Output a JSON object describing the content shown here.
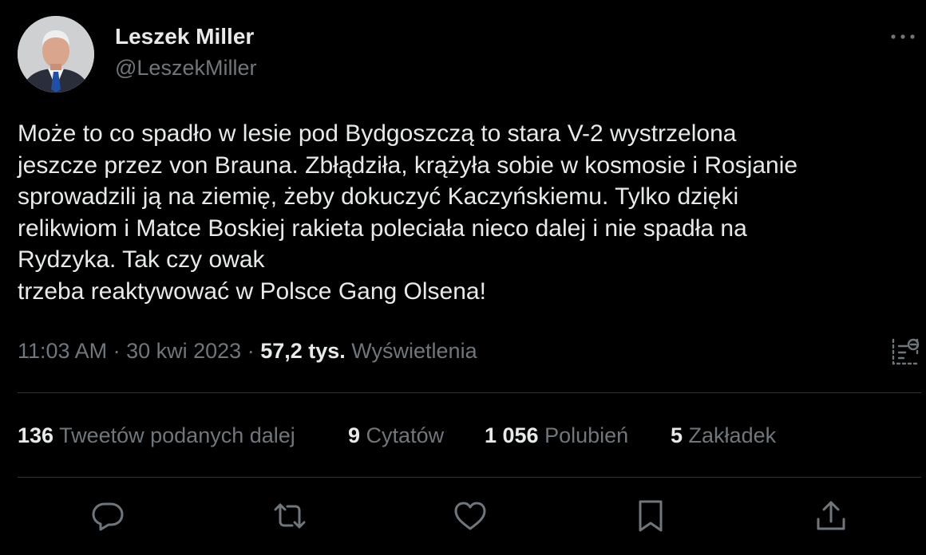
{
  "author": {
    "display_name": "Leszek Miller",
    "handle": "@LeszekMiller"
  },
  "tweet": {
    "text": "Może to co spadło w lesie pod Bydgoszczą to stara V-2 wystrzelona\njeszcze przez von Brauna. Zbłądziła, krążyła sobie w kosmosie i Rosjanie\nsprowadzili ją na ziemię, żeby dokuczyć Kaczyńskiemu. Tylko dzięki\nrelikwiom i Matce Boskiej rakieta poleciała nieco dalej i nie spadła na\nRydzyka. Tak czy owak\ntrzeba reaktywować w Polsce Gang Olsena!"
  },
  "meta": {
    "time": "11:03 AM",
    "separator": " · ",
    "date": "30 kwi 2023",
    "views_count": "57,2 tys.",
    "views_label": "Wyświetlenia"
  },
  "stats": {
    "retweets": {
      "count": "136",
      "label": "Tweetów podanych dalej"
    },
    "quotes": {
      "count": "9",
      "label": "Cytatów"
    },
    "likes": {
      "count": "1 056",
      "label": "Polubień"
    },
    "bookmarks": {
      "count": "5",
      "label": "Zakładek"
    }
  },
  "icons": {
    "more": "more-horizontal-icon",
    "analytics": "view-analytics-icon",
    "reply": "reply-icon",
    "retweet": "retweet-icon",
    "like": "like-icon",
    "bookmark": "bookmark-icon",
    "share": "share-icon"
  },
  "colors": {
    "background": "#000000",
    "text_primary": "#e7e9ea",
    "text_secondary": "#71767b",
    "divider": "#2f3336"
  }
}
